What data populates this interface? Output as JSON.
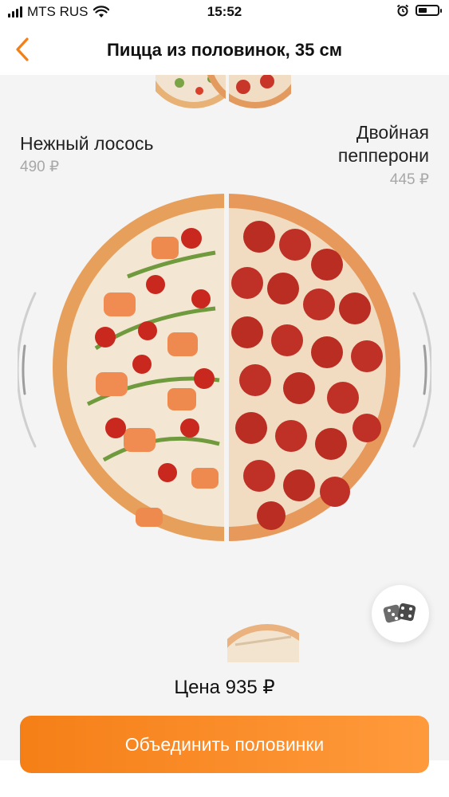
{
  "status_bar": {
    "carrier": "MTS RUS",
    "time": "15:52",
    "icons": [
      "signal-icon",
      "wifi-icon",
      "alarm-icon",
      "battery-icon"
    ]
  },
  "header": {
    "title": "Пицца из половинок, 35 см",
    "back_icon": "chevron-left-icon",
    "accent_color": "#f57f17"
  },
  "halves": {
    "left": {
      "name": "Нежный лосось",
      "price": "490 ₽"
    },
    "right": {
      "name": "Двойная пепперони",
      "price": "445 ₽"
    }
  },
  "random_button": {
    "icon": "dice-icon"
  },
  "footer": {
    "price_text": "Цена 935 ₽",
    "combine_label": "Объединить половинки",
    "button_color": "#f57f17"
  }
}
